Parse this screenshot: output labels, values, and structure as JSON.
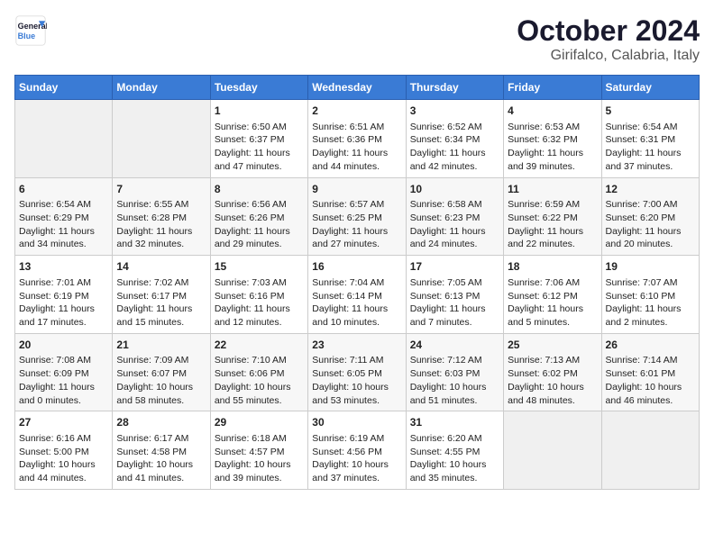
{
  "header": {
    "logo_line1": "General",
    "logo_line2": "Blue",
    "month": "October 2024",
    "location": "Girifalco, Calabria, Italy"
  },
  "days_of_week": [
    "Sunday",
    "Monday",
    "Tuesday",
    "Wednesday",
    "Thursday",
    "Friday",
    "Saturday"
  ],
  "weeks": [
    [
      {
        "day": "",
        "info": ""
      },
      {
        "day": "",
        "info": ""
      },
      {
        "day": "1",
        "info": "Sunrise: 6:50 AM\nSunset: 6:37 PM\nDaylight: 11 hours and 47 minutes."
      },
      {
        "day": "2",
        "info": "Sunrise: 6:51 AM\nSunset: 6:36 PM\nDaylight: 11 hours and 44 minutes."
      },
      {
        "day": "3",
        "info": "Sunrise: 6:52 AM\nSunset: 6:34 PM\nDaylight: 11 hours and 42 minutes."
      },
      {
        "day": "4",
        "info": "Sunrise: 6:53 AM\nSunset: 6:32 PM\nDaylight: 11 hours and 39 minutes."
      },
      {
        "day": "5",
        "info": "Sunrise: 6:54 AM\nSunset: 6:31 PM\nDaylight: 11 hours and 37 minutes."
      }
    ],
    [
      {
        "day": "6",
        "info": "Sunrise: 6:54 AM\nSunset: 6:29 PM\nDaylight: 11 hours and 34 minutes."
      },
      {
        "day": "7",
        "info": "Sunrise: 6:55 AM\nSunset: 6:28 PM\nDaylight: 11 hours and 32 minutes."
      },
      {
        "day": "8",
        "info": "Sunrise: 6:56 AM\nSunset: 6:26 PM\nDaylight: 11 hours and 29 minutes."
      },
      {
        "day": "9",
        "info": "Sunrise: 6:57 AM\nSunset: 6:25 PM\nDaylight: 11 hours and 27 minutes."
      },
      {
        "day": "10",
        "info": "Sunrise: 6:58 AM\nSunset: 6:23 PM\nDaylight: 11 hours and 24 minutes."
      },
      {
        "day": "11",
        "info": "Sunrise: 6:59 AM\nSunset: 6:22 PM\nDaylight: 11 hours and 22 minutes."
      },
      {
        "day": "12",
        "info": "Sunrise: 7:00 AM\nSunset: 6:20 PM\nDaylight: 11 hours and 20 minutes."
      }
    ],
    [
      {
        "day": "13",
        "info": "Sunrise: 7:01 AM\nSunset: 6:19 PM\nDaylight: 11 hours and 17 minutes."
      },
      {
        "day": "14",
        "info": "Sunrise: 7:02 AM\nSunset: 6:17 PM\nDaylight: 11 hours and 15 minutes."
      },
      {
        "day": "15",
        "info": "Sunrise: 7:03 AM\nSunset: 6:16 PM\nDaylight: 11 hours and 12 minutes."
      },
      {
        "day": "16",
        "info": "Sunrise: 7:04 AM\nSunset: 6:14 PM\nDaylight: 11 hours and 10 minutes."
      },
      {
        "day": "17",
        "info": "Sunrise: 7:05 AM\nSunset: 6:13 PM\nDaylight: 11 hours and 7 minutes."
      },
      {
        "day": "18",
        "info": "Sunrise: 7:06 AM\nSunset: 6:12 PM\nDaylight: 11 hours and 5 minutes."
      },
      {
        "day": "19",
        "info": "Sunrise: 7:07 AM\nSunset: 6:10 PM\nDaylight: 11 hours and 2 minutes."
      }
    ],
    [
      {
        "day": "20",
        "info": "Sunrise: 7:08 AM\nSunset: 6:09 PM\nDaylight: 11 hours and 0 minutes."
      },
      {
        "day": "21",
        "info": "Sunrise: 7:09 AM\nSunset: 6:07 PM\nDaylight: 10 hours and 58 minutes."
      },
      {
        "day": "22",
        "info": "Sunrise: 7:10 AM\nSunset: 6:06 PM\nDaylight: 10 hours and 55 minutes."
      },
      {
        "day": "23",
        "info": "Sunrise: 7:11 AM\nSunset: 6:05 PM\nDaylight: 10 hours and 53 minutes."
      },
      {
        "day": "24",
        "info": "Sunrise: 7:12 AM\nSunset: 6:03 PM\nDaylight: 10 hours and 51 minutes."
      },
      {
        "day": "25",
        "info": "Sunrise: 7:13 AM\nSunset: 6:02 PM\nDaylight: 10 hours and 48 minutes."
      },
      {
        "day": "26",
        "info": "Sunrise: 7:14 AM\nSunset: 6:01 PM\nDaylight: 10 hours and 46 minutes."
      }
    ],
    [
      {
        "day": "27",
        "info": "Sunrise: 6:16 AM\nSunset: 5:00 PM\nDaylight: 10 hours and 44 minutes."
      },
      {
        "day": "28",
        "info": "Sunrise: 6:17 AM\nSunset: 4:58 PM\nDaylight: 10 hours and 41 minutes."
      },
      {
        "day": "29",
        "info": "Sunrise: 6:18 AM\nSunset: 4:57 PM\nDaylight: 10 hours and 39 minutes."
      },
      {
        "day": "30",
        "info": "Sunrise: 6:19 AM\nSunset: 4:56 PM\nDaylight: 10 hours and 37 minutes."
      },
      {
        "day": "31",
        "info": "Sunrise: 6:20 AM\nSunset: 4:55 PM\nDaylight: 10 hours and 35 minutes."
      },
      {
        "day": "",
        "info": ""
      },
      {
        "day": "",
        "info": ""
      }
    ]
  ]
}
